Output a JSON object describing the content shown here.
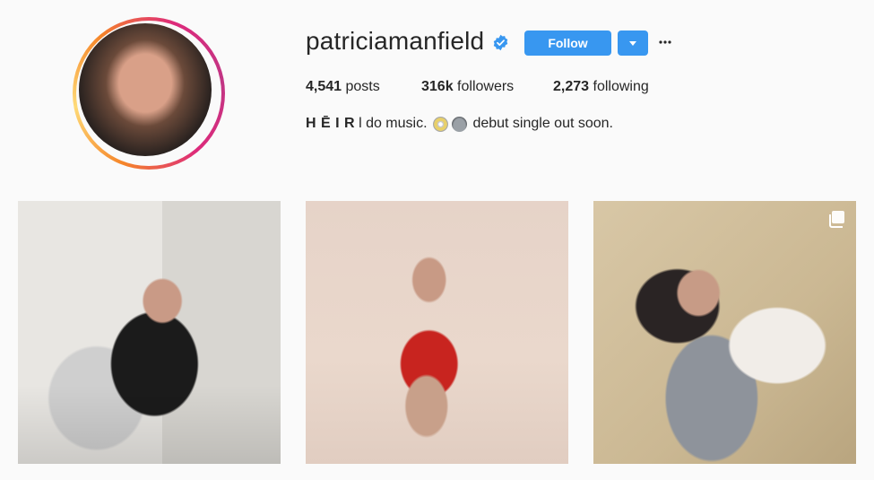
{
  "profile": {
    "username": "patriciamanfield",
    "verified_icon": "verified-badge-icon",
    "follow_label": "Follow",
    "dropdown_icon": "caret-down-icon",
    "more_icon": "more-options-icon",
    "avatar_icon": "profile-avatar",
    "accent_color": "#3897f0"
  },
  "stats": {
    "posts_count": "4,541",
    "posts_label": "posts",
    "followers_count": "316k",
    "followers_label": "followers",
    "following_count": "2,273",
    "following_label": "following"
  },
  "bio": {
    "name": "H Ē I R",
    "text_before_emoji": "l do music.",
    "emoji_1": "dvd-disc-icon",
    "emoji_2": "alien-icon",
    "text_after_emoji": "debut single out soon."
  },
  "posts": [
    {
      "id": "post-1",
      "kind": "photo"
    },
    {
      "id": "post-2",
      "kind": "photo"
    },
    {
      "id": "post-3",
      "kind": "carousel",
      "badge_icon": "multiple-photos-icon"
    }
  ]
}
